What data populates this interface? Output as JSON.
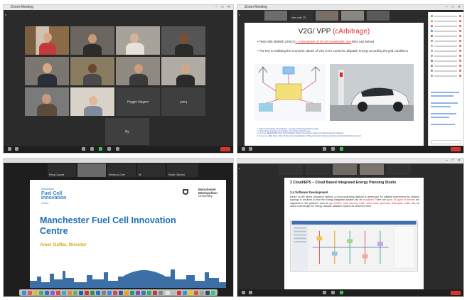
{
  "top_left": {
    "window_title": "Zoom Meeting",
    "participants": [
      {
        "name": ""
      },
      {
        "name": ""
      },
      {
        "name": ""
      },
      {
        "name": ""
      },
      {
        "name": ""
      },
      {
        "name": ""
      },
      {
        "name": ""
      },
      {
        "name": ""
      },
      {
        "name": ""
      },
      {
        "name": ""
      },
      {
        "name": "Peggie Magem"
      },
      {
        "name": "yanq"
      },
      {
        "name": "lily"
      }
    ]
  },
  "top_right": {
    "window_title": "Zoom Meeting",
    "strip_names": [
      "",
      "haru cafe, 刘",
      "",
      "",
      ""
    ],
    "slide": {
      "title_main": "V2G/ VPP",
      "title_highlight": "(cArbitrage)",
      "bullets": [
        {
          "text": "Tesla S85 (85kWh,225m) (",
          "underlined": "≈ consumption of 10 UK households; see",
          "tail": " links 1&2 below)"
        },
        {
          "text": "The key to realising the economic values of V2X is EV control to dispatch energy according the grid conditions",
          "underlined": "",
          "tail": ""
        }
      ],
      "refs": [
        "1. https://www.statista.com/statistics/...average-household-electricity-usage",
        "2. https://www.ovoenergy.com/guides/...household-electricity-use",
        "3. Xu et al., IEEE/ASME 2019, Smart Wireless Power Transmission System for Autonomous EV Charging",
        "4. Fan et al., IEEE Trans. 2021, Bi-Directional Coordination of Plug-In Electric Vehicles with Economic Model Predictive Control"
      ]
    }
  },
  "bottom_left": {
    "strip": [
      {
        "name": "Peng Guanlei"
      },
      {
        "name": ""
      },
      {
        "name": "Rebecca Chen"
      },
      {
        "name": "Ni"
      },
      {
        "name": "Robin Gilchrist"
      }
    ],
    "slide": {
      "logo_line1": "Manchester",
      "logo_line2": "Fuel Cell",
      "logo_line3": "Innovation",
      "logo_line4": "Centre",
      "partner_logo": [
        "Manchester",
        "Metropolitan",
        "University"
      ],
      "title": "Manchester Fuel Cell Innovation Centre",
      "subtitle": "Amer Gaffar, Director"
    }
  },
  "bottom_right": {
    "strip_names": [
      "",
      "",
      "",
      "",
      ""
    ],
    "doc": {
      "heading": "3      CloudIEPS – Cloud Based Integrated Energy Planning Studio",
      "subheading": "3.4 Software Development",
      "para_a": "Based on the above simulation method, a cloud-computing platform is developed. An editable environment for network topology is provided so that the Energy-Integrated system can be ",
      "para_visualized": "visualized",
      "para_b": ". There are up to ",
      "para_devices": "25 types of devices",
      "para_c": " are supported in this platform, such as ",
      "para_list": "gas turbine, heat recovery boiler, wind power generator, absorption chiller",
      "para_d": ", etc, so users could design the energy cascade utilization system as what they want."
    }
  },
  "colors": {
    "zoom_dark": "#2b2b2b",
    "end_red": "#d9342b",
    "mfc_blue": "#2f7fc1",
    "mfc_gold": "#e0a21a",
    "slide_red": "#dd3333"
  }
}
